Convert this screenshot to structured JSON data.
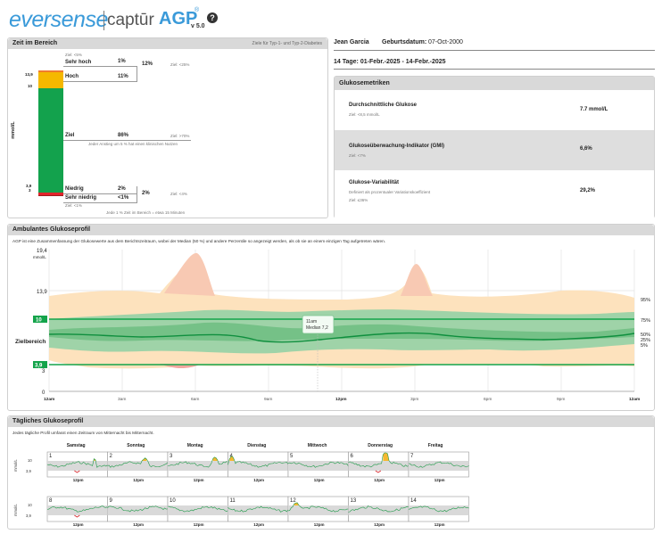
{
  "header": {
    "brand_eversense": "eversense",
    "brand_captur": "captūr",
    "brand_agp": "AGP",
    "brand_reg": "®",
    "brand_version": "v 5.0",
    "help_icon": "help-circle-icon"
  },
  "tir": {
    "title": "Zeit im Bereich",
    "subtitle": "Ziele für Typ-1- und Typ-2-Diabetes",
    "unit": "mmol/L",
    "ticks": [
      "13,9",
      "10",
      "3,9",
      "3"
    ],
    "very_high": {
      "goal_above": "Ziel: <5%",
      "label": "Sehr hoch",
      "value": "1%"
    },
    "high": {
      "label": "Hoch",
      "value": "11%"
    },
    "high_combined": {
      "value": "12%",
      "goal": "Ziel: <25%"
    },
    "target": {
      "label": "Ziel",
      "value": "86%",
      "goal": "Ziel: >70%",
      "note": "Jeder Anstieg um 5 % hat einen klinischen Nutzen"
    },
    "low": {
      "label": "Niedrig",
      "value": "2%"
    },
    "low_combined": {
      "value": "2%",
      "goal": "Ziel: <4%"
    },
    "very_low": {
      "label": "Sehr niedrig",
      "value": "<1%",
      "goal_below": "Ziel: <1%"
    },
    "footer": "Jede 1 % Zeit im Bereich = etwa 15 Minuten",
    "levels": {
      "very_high": 1,
      "high": 11,
      "target": 86,
      "low": 2,
      "very_low": 0.5
    },
    "colors": {
      "very_high": "#f07b2f",
      "high": "#f5b800",
      "target": "#13a24d",
      "low": "#e2242b",
      "very_low": "#a21a1e"
    }
  },
  "patient": {
    "name": "Jean Garcia",
    "dob_label": "Geburtsdatum:",
    "dob": "07-Oct-2000",
    "period": "14 Tage: 01-Febr.-2025 - 14-Febr.-2025"
  },
  "metrics": {
    "title": "Glukosemetriken",
    "rows": [
      {
        "name": "Durchschnittliche Glukose",
        "goal": "Ziel: <8,5 mmol/L",
        "goal2": "",
        "value": "7.7 mmol/L"
      },
      {
        "name": "Glukoseüberwachung-Indikator (GMI)",
        "goal": "Ziel: <7%",
        "goal2": "",
        "value": "6,6%"
      },
      {
        "name": "Glukose-Variabilität",
        "goal": "Definiert als prozentualer Variationskoeffizient",
        "goal2": "Ziel: ≤36%",
        "value": "29,2%"
      }
    ]
  },
  "agp": {
    "title": "Ambulantes Glukoseprofil",
    "description": "AGP ist eine Zusammenfassung der Glukosewerte aus dem Berichtszeitraum, wobei der Median (50 %) und andere Perzentile so angezeigt werden, als ob sie an einem einzigen Tag aufgetreten wären.",
    "unit": "mmol/L",
    "y_ticks": [
      "19,4",
      "13,9",
      "3",
      "0"
    ],
    "target_high_badge": "10",
    "target_low_badge": "3,9",
    "range_label": "Zielbereich",
    "x_ticks": [
      "12am",
      "3am",
      "6am",
      "9am",
      "12pm",
      "3pm",
      "6pm",
      "9pm",
      "12am"
    ],
    "percentiles": [
      "95%",
      "75%",
      "50%",
      "25%",
      "5%"
    ],
    "tooltip_time": "11am",
    "tooltip_median": "Median 7,2",
    "colors": {
      "band_outer": "#fde2bd",
      "band_inner": "#9fd3a8",
      "band_core": "#67bb7c",
      "median": "#0f8f3e",
      "target_line": "#14a44b",
      "spike": "#f8c9b3"
    }
  },
  "daily": {
    "title": "Tägliches Glukoseprofil",
    "description": "Jedes tägliche Profil umfasst einen Zeitraum von Mitternacht bis Mitternacht.",
    "unit": "mmol/L",
    "y_ticks": [
      "10",
      "3,9"
    ],
    "weekdays": [
      "Samstag",
      "Sonntag",
      "Montag",
      "Dienstag",
      "Mittwoch",
      "Donnerstag",
      "Freitag"
    ],
    "noon_label": "12pm",
    "week1": [
      "1",
      "2",
      "3",
      "4",
      "5",
      "6",
      "7"
    ],
    "week2": [
      "8",
      "9",
      "10",
      "11",
      "12",
      "13",
      "14"
    ]
  }
}
